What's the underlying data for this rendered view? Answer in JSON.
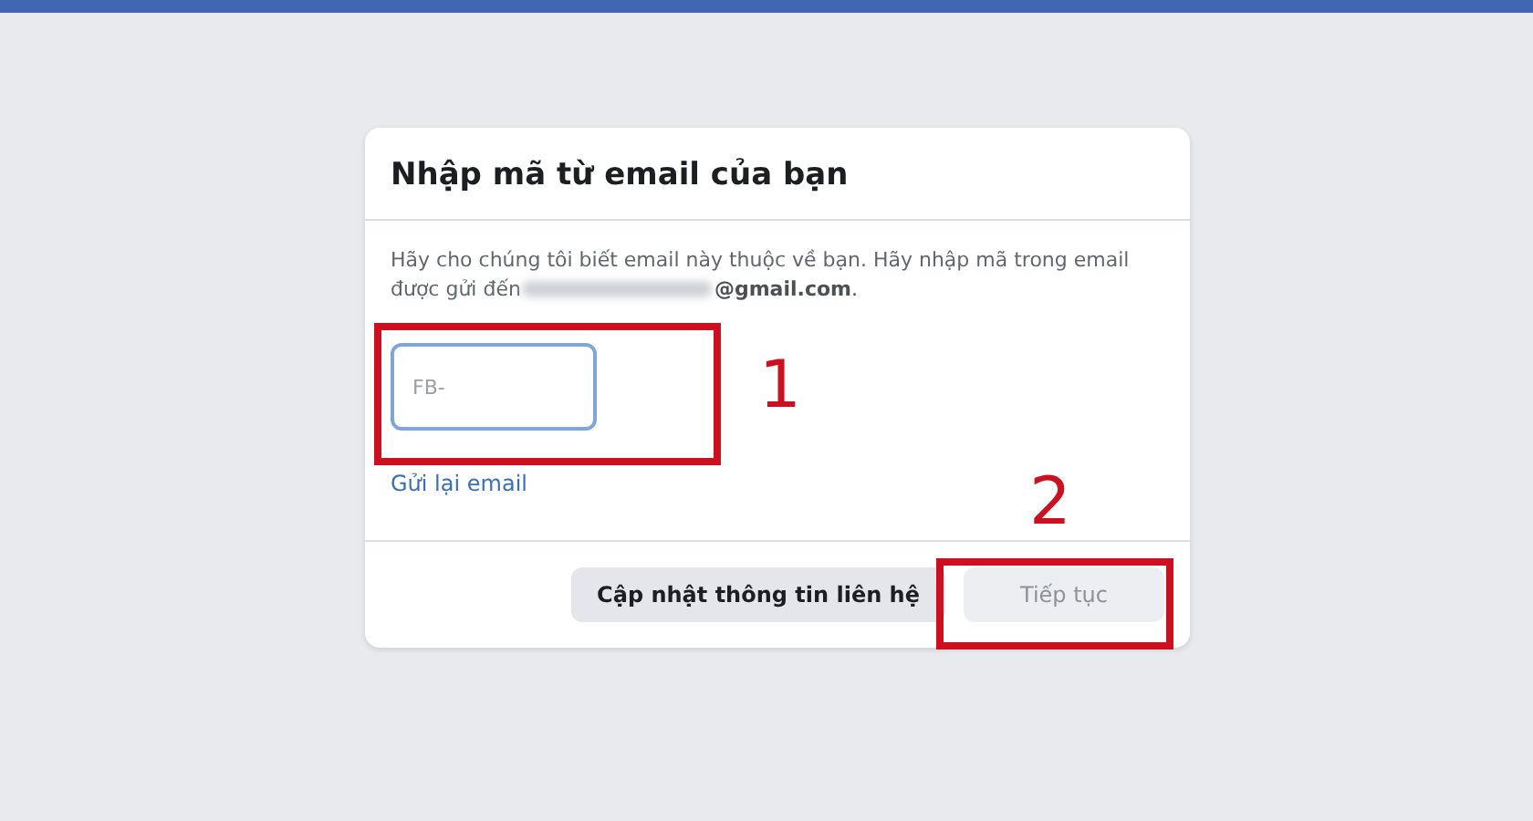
{
  "dialog": {
    "title": "Nhập mã từ email của bạn",
    "description": "Hãy cho chúng tôi biết email này thuộc về bạn. Hãy nhập mã trong email được gửi đến",
    "email_suffix": "**@gmail.com**.",
    "code_field": {
      "placeholder": "FB-"
    },
    "resend_link": "Gửi lại email",
    "buttons": [
      {
        "label": "Cập nhật thông tin liên hệ",
        "disabled": false
      },
      {
        "label": "Tiếp tục",
        "disabled": true
      }
    ]
  },
  "annotations": [
    {
      "label": "1",
      "kind": "field"
    },
    {
      "label": "2",
      "kind": "button"
    }
  ]
}
